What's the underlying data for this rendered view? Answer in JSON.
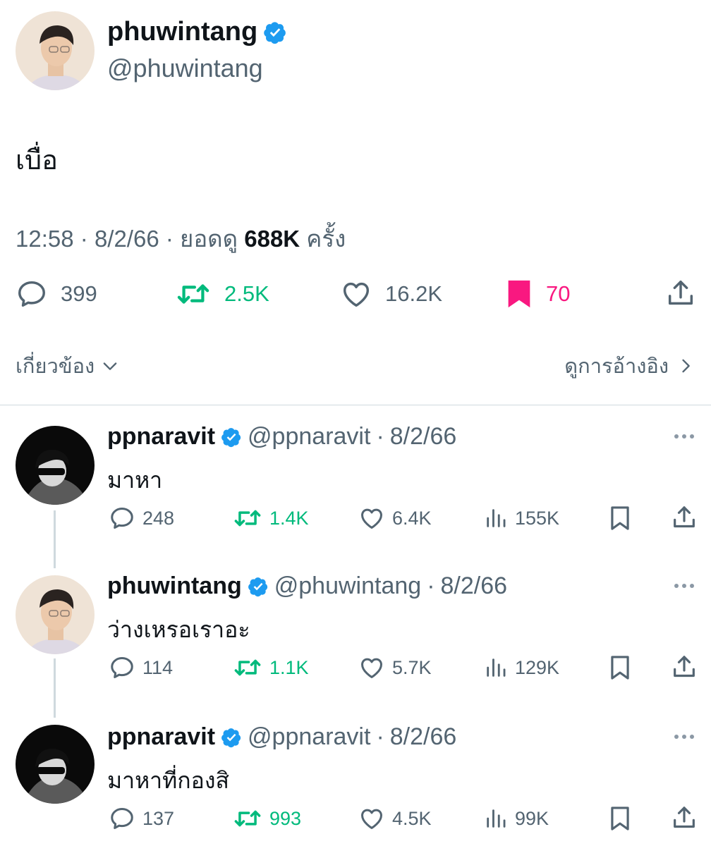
{
  "main_tweet": {
    "display_name": "phuwintang",
    "handle": "@phuwintang",
    "text": "เบื่อ",
    "time": "12:58",
    "date": "8/2/66",
    "views_prefix": "ยอดดู",
    "views_count": "688K",
    "views_suffix": "ครั้ง",
    "replies": "399",
    "retweets": "2.5K",
    "likes": "16.2K",
    "bookmarks": "70",
    "related_label": "เกี่ยวข้อง",
    "quotes_label": "ดูการอ้างอิง"
  },
  "replies": [
    {
      "display_name": "ppnaravit",
      "handle": "@ppnaravit",
      "date": "8/2/66",
      "text": "มาหา",
      "replies": "248",
      "retweets": "1.4K",
      "likes": "6.4K",
      "views": "155K"
    },
    {
      "display_name": "phuwintang",
      "handle": "@phuwintang",
      "date": "8/2/66",
      "text": "ว่างเหรอเราอะ",
      "replies": "114",
      "retweets": "1.1K",
      "likes": "5.7K",
      "views": "129K"
    },
    {
      "display_name": "ppnaravit",
      "handle": "@ppnaravit",
      "date": "8/2/66",
      "text": "มาหาที่กองสิ",
      "replies": "137",
      "retweets": "993",
      "likes": "4.5K",
      "views": "99K"
    }
  ],
  "separator": "·",
  "colors": {
    "verified": "#1d9bf0",
    "retweet": "#00ba7c",
    "bookmark_active": "#f91880",
    "secondary_text": "#536471"
  },
  "icons": [
    "verified-badge-icon",
    "reply-icon",
    "retweet-icon",
    "like-icon",
    "bookmark-icon",
    "views-icon",
    "share-icon",
    "more-icon",
    "chevron-down-icon",
    "chevron-right-icon"
  ]
}
